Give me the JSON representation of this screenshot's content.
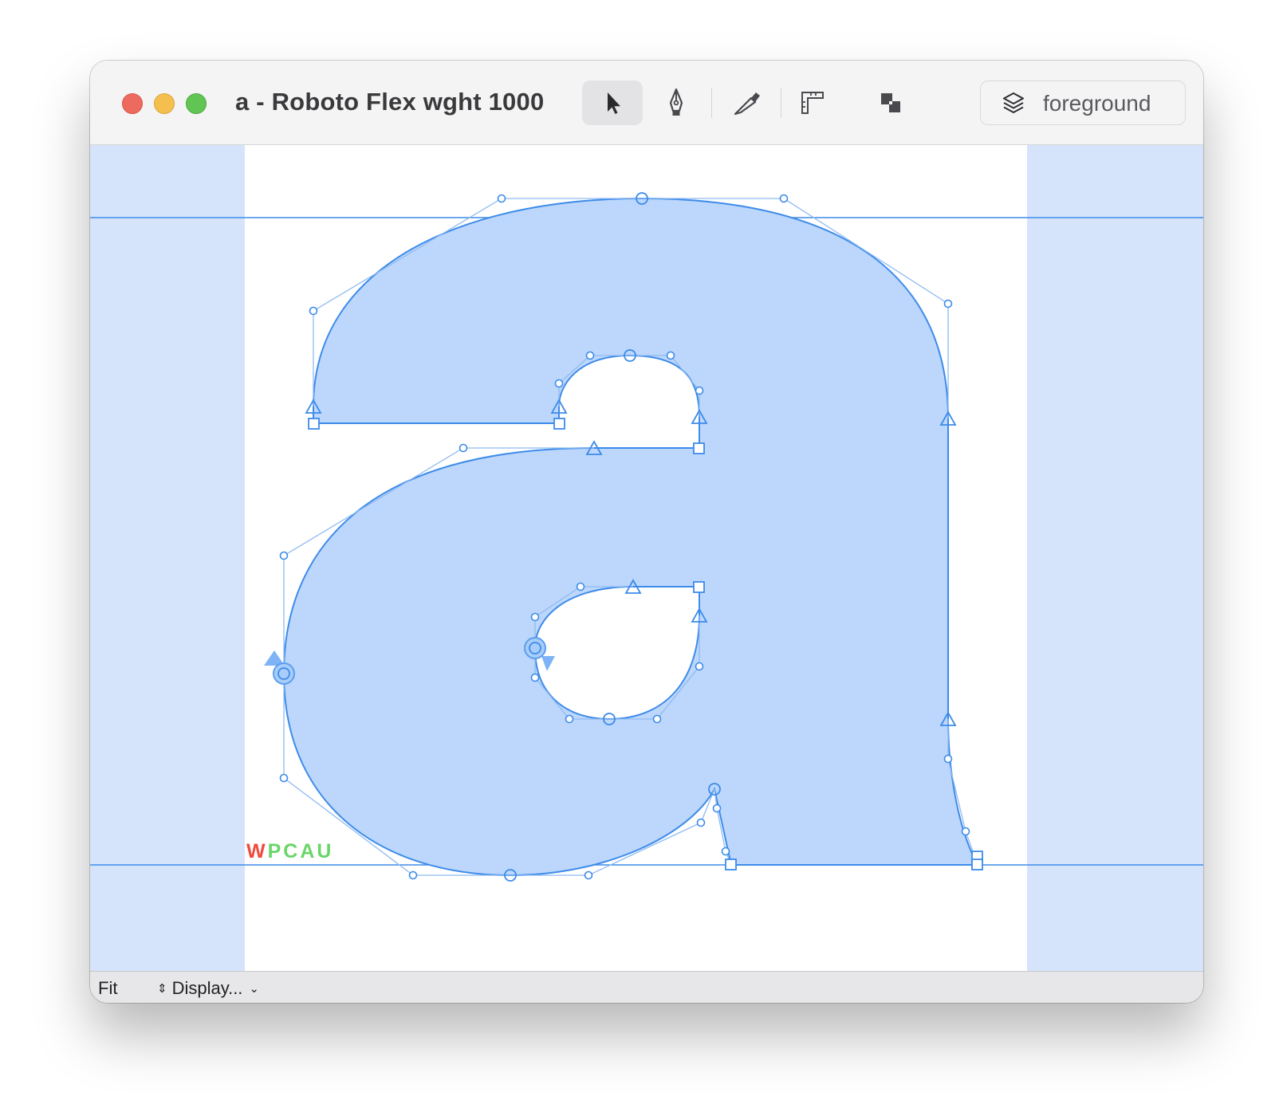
{
  "window": {
    "title": "a - Roboto Flex wght 1000"
  },
  "toolbar": {
    "tools": [
      {
        "name": "pointer-tool",
        "icon": "arrow-cursor-icon",
        "active": true
      },
      {
        "name": "pen-tool",
        "icon": "pen-nib-icon",
        "active": false
      },
      {
        "name": "knife-tool",
        "icon": "knife-icon",
        "active": false
      },
      {
        "name": "measure-tool",
        "icon": "ruler-corner-icon",
        "active": false
      },
      {
        "name": "components-tool",
        "icon": "overlap-squares-icon",
        "active": false
      }
    ],
    "layer_label": "foreground",
    "layer_icon": "layers-icon"
  },
  "canvas": {
    "glyph": "a",
    "fill_color": "#bcd7fb",
    "outline_color": "#3d8bea",
    "margin_color": "#d5e4fb",
    "wpcau": [
      {
        "letter": "W",
        "color": "#ee4b3e"
      },
      {
        "letter": "P",
        "color": "#6ad66a"
      },
      {
        "letter": "C",
        "color": "#6ad66a"
      },
      {
        "letter": "A",
        "color": "#6ad66a"
      },
      {
        "letter": "U",
        "color": "#6ad66a"
      }
    ]
  },
  "statusbar": {
    "zoom_label": "Fit",
    "display_label": "Display..."
  }
}
